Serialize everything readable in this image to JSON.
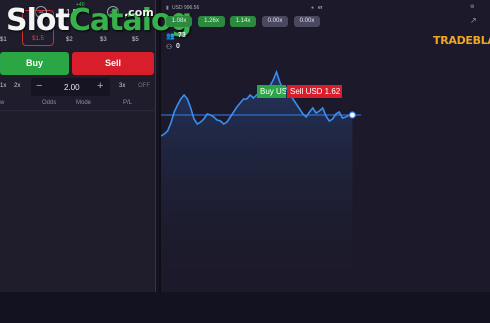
{
  "chips": [
    {
      "value": "$1",
      "selected": false
    },
    {
      "value": "$1.5",
      "selected": true
    },
    {
      "value": "$2",
      "selected": false
    },
    {
      "value": "$3",
      "selected": false
    },
    {
      "value": "$5",
      "selected": false
    }
  ],
  "top_amount": "1.5",
  "tiny_label": "+40",
  "watermark": {
    "slot": "Slot",
    "catalog": "Catalog",
    "com": ".com"
  },
  "buttons": {
    "buy": "Buy",
    "sell": "Sell"
  },
  "multipliers": {
    "m1": "1x",
    "m2": "2x",
    "m3": "3x",
    "off": "OFF"
  },
  "stake": {
    "value": "2.00",
    "minus": "−",
    "plus": "+"
  },
  "columns": {
    "dir": "w",
    "odds": "Odds",
    "mode": "Mode",
    "pl": "P/L"
  },
  "balance": "USD 996.56",
  "top_right_label": "er",
  "pills": [
    {
      "label": "1.08x",
      "color": "green"
    },
    {
      "label": "1.26x",
      "color": "green"
    },
    {
      "label": "1.14x",
      "color": "green"
    },
    {
      "label": "0.00x",
      "color": "gray"
    },
    {
      "label": "0.00x",
      "color": "gray"
    }
  ],
  "users_count": "73",
  "second_count": "0",
  "brand": "TRADEBLAZ",
  "tags": {
    "buy": "Buy US",
    "sell": "Sell USD 1.62"
  },
  "chart_data": {
    "type": "line",
    "y": [
      34,
      36,
      39,
      47,
      58,
      65,
      71,
      75,
      71,
      62,
      51,
      46,
      48,
      51,
      56,
      55,
      53,
      50,
      49,
      46,
      48,
      53,
      58,
      63,
      67,
      71,
      71,
      75,
      72,
      75,
      77,
      79,
      84,
      84,
      90,
      98,
      88,
      80,
      82,
      76,
      71,
      66,
      61,
      56,
      53,
      58,
      62,
      57,
      59,
      62,
      54,
      49,
      51,
      56,
      58,
      52,
      53,
      55,
      55
    ],
    "baseline": 55,
    "colors": {
      "line": "#3a8ef0",
      "fill_top": "#2a4a8a",
      "baseline": "#2f7ff0",
      "marker": "#ffffff"
    }
  }
}
